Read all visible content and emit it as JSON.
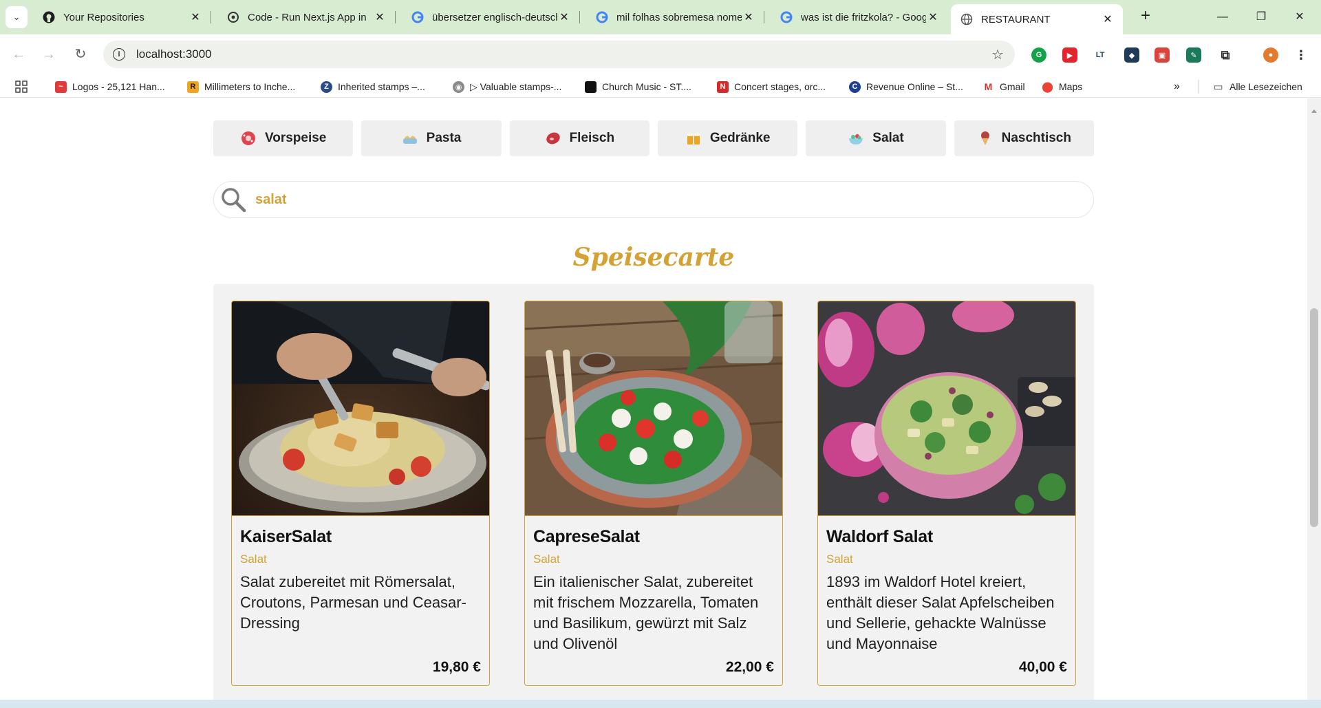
{
  "browser": {
    "tabs": [
      {
        "title": "Your Repositories",
        "favicon": "github-icon"
      },
      {
        "title": "Code - Run Next.js App in",
        "favicon": "chatgpt-icon"
      },
      {
        "title": "übersetzer englisch-deutsch",
        "favicon": "google-icon"
      },
      {
        "title": "mil folhas sobremesa nome",
        "favicon": "google-icon"
      },
      {
        "title": "was ist die fritzkola? - Goog",
        "favicon": "google-icon"
      },
      {
        "title": "RESTAURANT",
        "favicon": "globe-icon",
        "active": true
      }
    ],
    "url": "localhost:3000",
    "bookmarks": [
      {
        "label": "Logos - 25,121 Han..."
      },
      {
        "label": "Millimeters to Inche..."
      },
      {
        "label": "Inherited stamps –..."
      },
      {
        "label": "▷ Valuable stamps-..."
      },
      {
        "label": "Church Music - ST...."
      },
      {
        "label": "Concert stages, orc..."
      },
      {
        "label": "Revenue Online – St..."
      },
      {
        "label": "Gmail"
      },
      {
        "label": "Maps"
      }
    ],
    "all_bookmarks": "Alle Lesezeichen"
  },
  "categories": [
    {
      "label": "Vorspeise",
      "icon": "appetizer-icon",
      "color": "#e0444f"
    },
    {
      "label": "Pasta",
      "icon": "pasta-icon",
      "color": "#f2c14e"
    },
    {
      "label": "Fleisch",
      "icon": "meat-icon",
      "color": "#c9353d"
    },
    {
      "label": "Gedränke",
      "icon": "drinks-icon",
      "color": "#f0a51f"
    },
    {
      "label": "Salat",
      "icon": "salad-icon",
      "color": "#5bbf8e"
    },
    {
      "label": "Naschtisch",
      "icon": "dessert-icon",
      "color": "#b5443f"
    }
  ],
  "search": {
    "value": "salat"
  },
  "menu_title": "Speisecarte",
  "items": [
    {
      "name": "KaiserSalat",
      "category": "Salat",
      "description": "Salat zubereitet mit Römersalat, Croutons, Parmesan und Ceasar-Dressing",
      "price": "19,80 €"
    },
    {
      "name": "CapreseSalat",
      "category": "Salat",
      "description": "Ein italienischer Salat, zubereitet mit frischem Mozzarella, Tomaten und Basilikum, gewürzt mit Salz und Olivenöl",
      "price": "22,00 €"
    },
    {
      "name": "Waldorf Salat",
      "category": "Salat",
      "description": "1893 im Waldorf Hotel kreiert, enthält dieser Salat Apfelscheiben und Sellerie, gehackte Walnüsse und Mayonnaise",
      "price": "40,00 €"
    }
  ],
  "colors": {
    "accent": "#d4a234",
    "panel": "#f2f2f2"
  }
}
